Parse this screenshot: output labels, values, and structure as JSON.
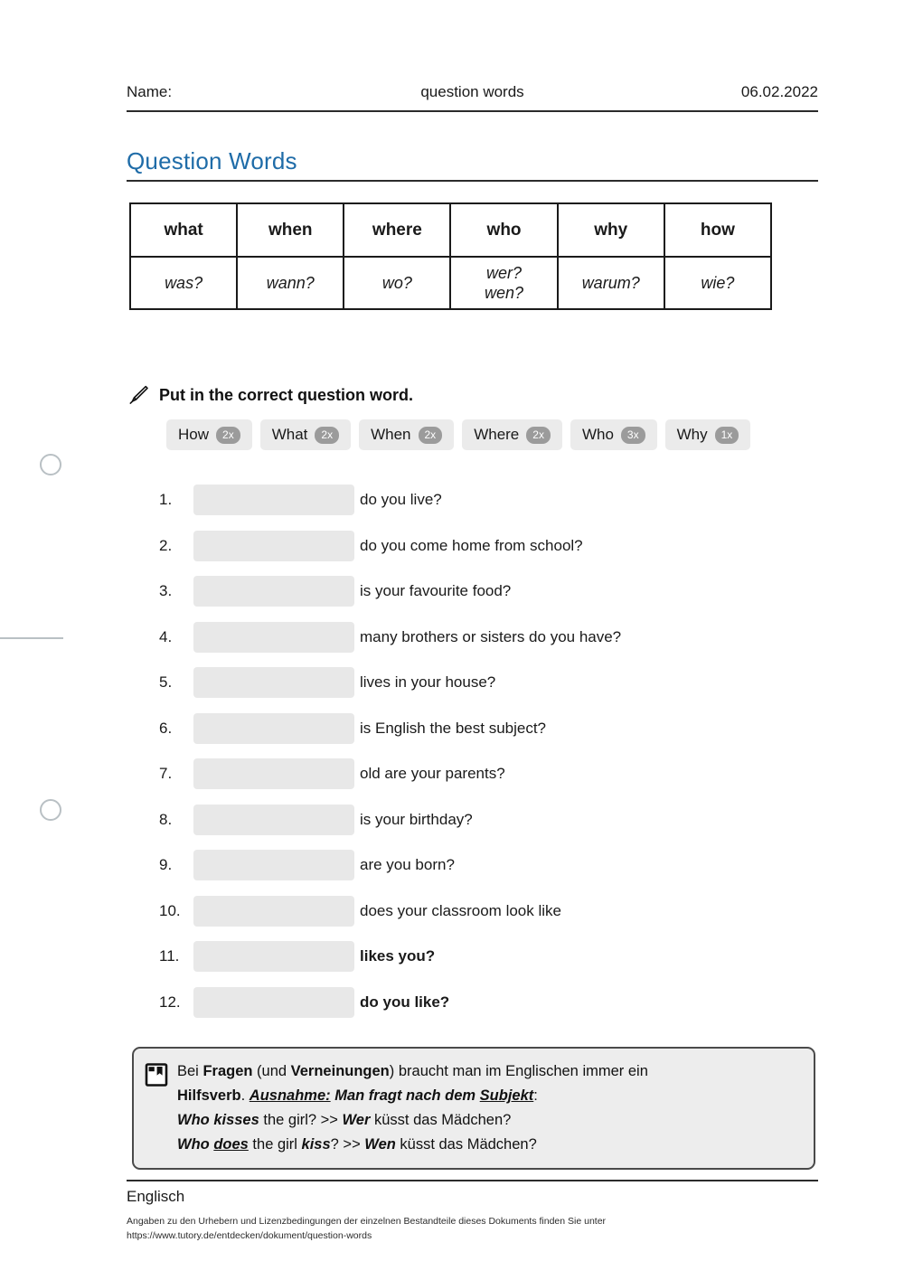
{
  "header": {
    "name_label": "Name:",
    "doc_title": "question words",
    "date": "06.02.2022"
  },
  "title": "Question Words",
  "colors": {
    "title_blue": "#1f6ca8",
    "chip_bg": "#ebebeb",
    "badge_gray": "#9b9b9b",
    "blank_gray": "#e8e8e8",
    "infobox_bg": "#ededed",
    "infobox_border": "#4a4a4a",
    "margin_marker": "#b9c0c4"
  },
  "words_table": {
    "english": [
      "what",
      "when",
      "where",
      "who",
      "why",
      "how"
    ],
    "german": [
      "was?",
      "wann?",
      "wo?",
      "wer?\nwen?",
      "warum?",
      "wie?"
    ],
    "german_who_line1": "wer?",
    "german_who_line2": "wen?"
  },
  "instruction": {
    "icon": "pencil-icon",
    "text": "Put in the correct question word."
  },
  "wordbank": [
    {
      "word": "How",
      "count": "2x"
    },
    {
      "word": "What",
      "count": "2x"
    },
    {
      "word": "When",
      "count": "2x"
    },
    {
      "word": "Where",
      "count": "2x"
    },
    {
      "word": "Who",
      "count": "3x"
    },
    {
      "word": "Why",
      "count": "1x"
    }
  ],
  "exercises": [
    {
      "num": "1.",
      "text": "do you live?",
      "bold": false
    },
    {
      "num": "2.",
      "text": "do you come home from school?",
      "bold": false
    },
    {
      "num": "3.",
      "text": "is your favourite food?",
      "bold": false
    },
    {
      "num": "4.",
      "text": "many brothers or sisters do you have?",
      "bold": false
    },
    {
      "num": "5.",
      "text": "lives in your house?",
      "bold": false
    },
    {
      "num": "6.",
      "text": "is English the best subject?",
      "bold": false
    },
    {
      "num": "7.",
      "text": "old are your parents?",
      "bold": false
    },
    {
      "num": "8.",
      "text": "is your birthday?",
      "bold": false
    },
    {
      "num": "9.",
      "text": "are you born?",
      "bold": false
    },
    {
      "num": "10.",
      "text": "does your classroom look like",
      "bold": false
    },
    {
      "num": "11.",
      "text": "likes you?",
      "bold": true
    },
    {
      "num": "12.",
      "text": "do you like?",
      "bold": true
    }
  ],
  "infobox": {
    "icon": "book-icon",
    "line1_a": "Bei ",
    "line1_b": "Fragen",
    "line1_c": " (und ",
    "line1_d": "Verneinungen",
    "line1_e": ") braucht man im Englischen immer ein ",
    "line2_a": "Hilfsverb",
    "line2_b": ". ",
    "line2_c": "Ausnahme:",
    "line2_d": " Man fragt nach dem ",
    "line2_e": "Subjekt",
    "line2_f": ":",
    "line3_a": "Who kisses",
    "line3_b": " the girl? >> ",
    "line3_c": "Wer",
    "line3_d": " küsst das Mädchen?",
    "line4_a": "Who ",
    "line4_b": "does",
    "line4_c": " the girl ",
    "line4_d": "kiss",
    "line4_e": "? >> ",
    "line4_f": "Wen",
    "line4_g": " küsst das Mädchen?"
  },
  "footer": {
    "subject": "Englisch",
    "note_line1": "Angaben zu den Urhebern und Lizenzbedingungen der einzelnen Bestandteile dieses Dokuments finden Sie unter",
    "note_line2": "https://www.tutory.de/entdecken/dokument/question-words"
  }
}
